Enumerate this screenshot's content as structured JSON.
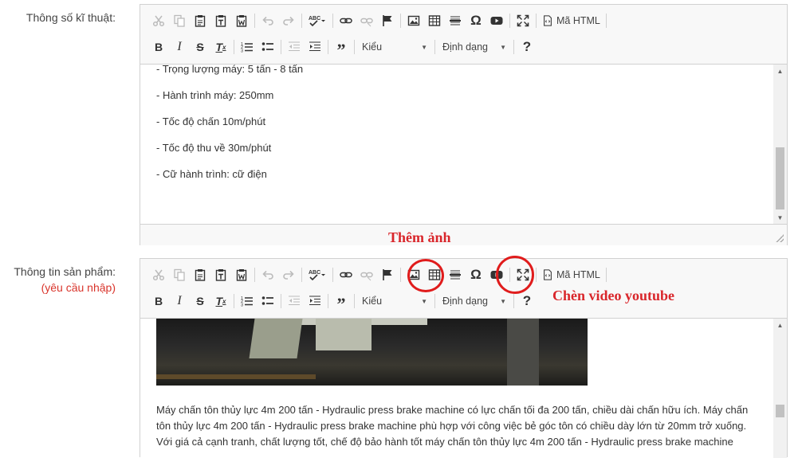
{
  "field1": {
    "label": "Thông số kĩ thuật:",
    "content_lines": [
      "- Trọng lượng máy: 5 tấn - 8 tấn",
      "- Hành trình máy: 250mm",
      "- Tốc độ chấn 10m/phút",
      "- Tốc độ thu về 30m/phút",
      "- Cữ hành trình: cữ điện"
    ]
  },
  "field2": {
    "label": "Thông tin sản phẩm:",
    "required": "(yêu cầu nhập)",
    "paragraph": "Máy chấn tôn thủy lực 4m 200 tấn - Hydraulic press brake machine có lực chấn tối đa 200 tấn, chiều dài chấn hữu ích. Máy chấn tôn thủy lực 4m 200 tấn - Hydraulic press brake machine phù hợp với công việc bẻ góc tôn có chiều dày lớn từ 20mm trở xuống. Với giá cả cạnh tranh, chất lượng tốt, chế độ bảo hành tốt máy chấn tôn thủy lực 4m 200 tấn - Hydraulic press brake machine"
  },
  "toolbar": {
    "style_combo": "Kiểu",
    "format_combo": "Định dạng",
    "source_label": "Mã HTML",
    "help": "?"
  },
  "annotations": {
    "add_image": "Thêm ảnh",
    "insert_video": "Chèn video youtube",
    "color": "#d9262b"
  },
  "icons": [
    "cut-icon",
    "copy-icon",
    "paste-icon",
    "paste-text-icon",
    "paste-word-icon",
    "undo-icon",
    "redo-icon",
    "spellcheck-icon",
    "link-icon",
    "unlink-icon",
    "anchor-icon",
    "image-icon",
    "table-icon",
    "horizontal-line-icon",
    "special-char-icon",
    "youtube-icon",
    "maximize-icon",
    "source-icon",
    "bold-icon",
    "italic-icon",
    "strike-icon",
    "remove-format-icon",
    "numbered-list-icon",
    "bulleted-list-icon",
    "outdent-icon",
    "indent-icon",
    "blockquote-icon"
  ]
}
